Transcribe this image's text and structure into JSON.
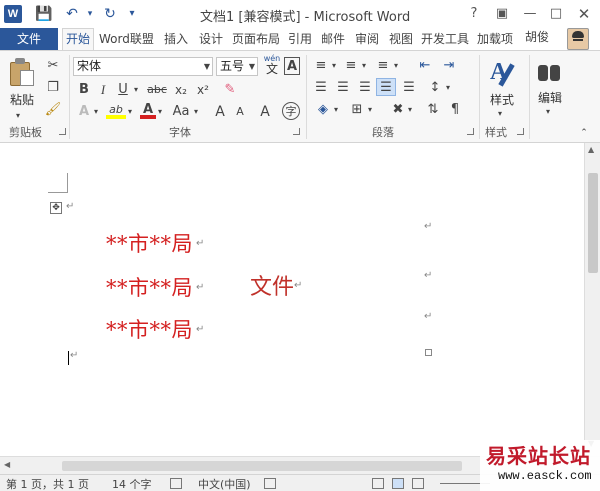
{
  "titlebar": {
    "title": "文档1 [兼容模式] - Microsoft Word",
    "logo_text": "W",
    "quick_access": [
      "save-icon",
      "undo-icon",
      "redo-icon",
      "customize-icon"
    ],
    "window_buttons": [
      "help-icon",
      "ribbon-display-icon",
      "minimize-icon",
      "restore-icon",
      "close-icon"
    ]
  },
  "tabs": {
    "file": "文件",
    "items": [
      "开始",
      "Word联盟",
      "插入",
      "设计",
      "页面布局",
      "引用",
      "邮件",
      "审阅",
      "视图",
      "开发工具",
      "加载项"
    ],
    "active_index": 0,
    "user": "胡俊"
  },
  "ribbon": {
    "clipboard": {
      "paste_label": "粘贴",
      "group_label": "剪贴板"
    },
    "font": {
      "font_name": "宋体",
      "font_size": "五号",
      "wen_top": "wén",
      "wen_bottom": "文",
      "box_a": "A",
      "bold": "B",
      "italic": "I",
      "underline": "U",
      "strike": "abc",
      "subscript": "x₂",
      "superscript": "x²",
      "text_effects": "A",
      "highlight": "ab",
      "font_color": "A",
      "change_case": "Aa",
      "grow": "A",
      "shrink": "A",
      "enclose": "字",
      "group_label": "字体"
    },
    "paragraph": {
      "group_label": "段落"
    },
    "styles": {
      "label": "样式",
      "group_label": "样式"
    },
    "editing": {
      "label": "编辑"
    }
  },
  "document": {
    "lines": [
      "**市**局",
      "**市**局",
      "**市**局"
    ],
    "file_word": "文件"
  },
  "status": {
    "page": "第 1 页，共 1 页",
    "words": "14 个字",
    "language": "中文(中国)"
  },
  "watermark": {
    "title": "易采站长站",
    "url": "www.easck.com"
  },
  "colors": {
    "brand": "#2b579a",
    "doc_text_red": "#d42020",
    "watermark_red": "#c11a2b"
  }
}
